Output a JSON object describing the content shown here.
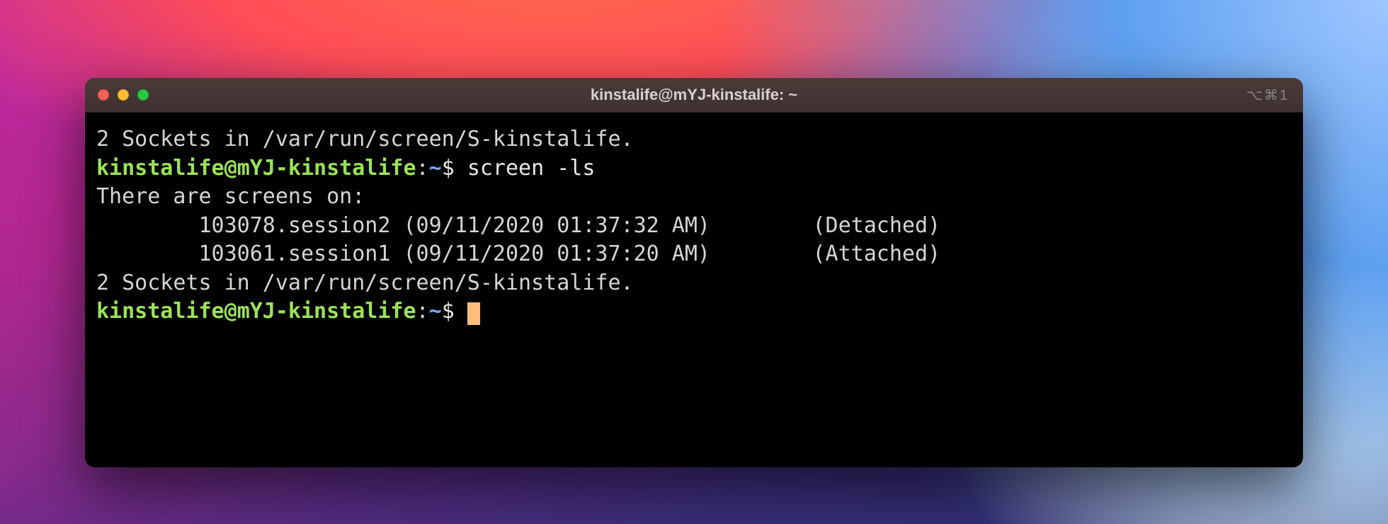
{
  "window": {
    "title": "kinstalife@mYJ-kinstalife: ~",
    "shortcut": "⌥⌘1"
  },
  "prompt": {
    "user": "kinstalife",
    "at": "@",
    "host": "mYJ-kinstalife",
    "colon": ":",
    "path": "~",
    "dollar": "$ "
  },
  "lines": {
    "sockets_header": "2 Sockets in /var/run/screen/S-kinstalife.",
    "command1": "screen -ls",
    "there_are": "There are screens on:",
    "session2": "        103078.session2 (09/11/2020 01:37:32 AM)        (Detached)",
    "session1": "        103061.session1 (09/11/2020 01:37:20 AM)        (Attached)",
    "sockets_footer": "2 Sockets in /var/run/screen/S-kinstalife."
  }
}
